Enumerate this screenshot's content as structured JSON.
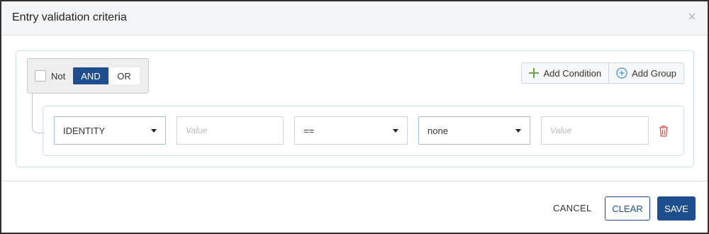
{
  "dialog": {
    "title": "Entry validation criteria",
    "close_icon": "close-icon"
  },
  "group": {
    "not_label": "Not",
    "not_checked": false,
    "and_label": "AND",
    "or_label": "OR",
    "selected_operator": "AND"
  },
  "actions": {
    "add_condition_label": "Add Condition",
    "add_group_label": "Add Group"
  },
  "condition": {
    "field_value": "IDENTITY",
    "value1_placeholder": "Value",
    "operator_value": "==",
    "type_value": "none",
    "value2_placeholder": "Value",
    "delete_icon": "trash-icon"
  },
  "footer": {
    "cancel_label": "CANCEL",
    "clear_label": "CLEAR",
    "save_label": "SAVE"
  },
  "colors": {
    "primary": "#1f4e8e",
    "add_green": "#6aa84f",
    "add_blue": "#3a8fc4",
    "delete_red": "#d9534f"
  }
}
